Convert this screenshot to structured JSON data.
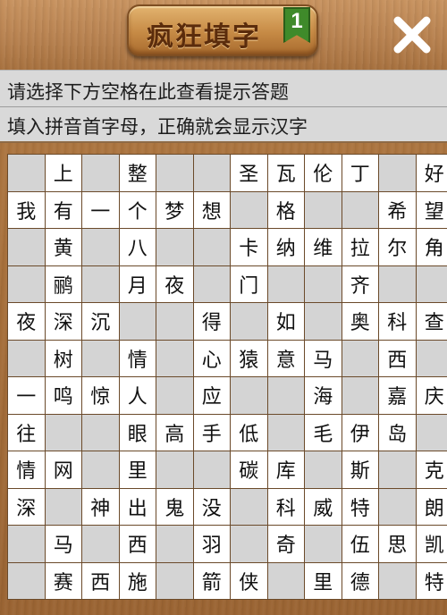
{
  "header": {
    "title": "疯狂填字",
    "level": "1",
    "close_icon": "close-x-icon"
  },
  "hints": {
    "line1": "请选择下方空格在此查看提示答题",
    "line2": "填入拼音首字母，正确就会显示汉字"
  },
  "colors": {
    "wood": "#a8713c",
    "hint_bg": "#d9d9d9",
    "blank_cell": "#d4d4d4",
    "letter_cell": "#ffffff",
    "badge_green": "#3f8a2a"
  },
  "grid": {
    "rows": 12,
    "cols": 12,
    "cells": [
      [
        "",
        "上",
        "",
        "整",
        "",
        "",
        "圣",
        "瓦",
        "伦",
        "丁",
        "",
        "好"
      ],
      [
        "我",
        "有",
        "一",
        "个",
        "梦",
        "想",
        "",
        "格",
        "",
        "",
        "希",
        "望"
      ],
      [
        "",
        "黄",
        "",
        "八",
        "",
        "",
        "卡",
        "纳",
        "维",
        "拉",
        "尔",
        "角"
      ],
      [
        "",
        "鹂",
        "",
        "月",
        "夜",
        "",
        "门",
        "",
        "",
        "齐",
        "",
        ""
      ],
      [
        "夜",
        "深",
        "沉",
        "",
        "",
        "得",
        "",
        "如",
        "",
        "奥",
        "科",
        "查"
      ],
      [
        "",
        "树",
        "",
        "情",
        "",
        "心",
        "猿",
        "意",
        "马",
        "",
        "西",
        ""
      ],
      [
        "一",
        "鸣",
        "惊",
        "人",
        "",
        "应",
        "",
        "",
        "海",
        "",
        "嘉",
        "庆"
      ],
      [
        "往",
        "",
        "",
        "眼",
        "高",
        "手",
        "低",
        "",
        "毛",
        "伊",
        "岛",
        ""
      ],
      [
        "情",
        "网",
        "",
        "里",
        "",
        "",
        "碳",
        "库",
        "",
        "斯",
        "",
        "克"
      ],
      [
        "深",
        "",
        "神",
        "出",
        "鬼",
        "没",
        "",
        "科",
        "威",
        "特",
        "",
        "朗"
      ],
      [
        "",
        "马",
        "",
        "西",
        "",
        "羽",
        "",
        "奇",
        "",
        "伍",
        "思",
        "凯"
      ],
      [
        "",
        "赛",
        "西",
        "施",
        "",
        "箭",
        "侠",
        "",
        "里",
        "德",
        "",
        "特"
      ]
    ]
  }
}
